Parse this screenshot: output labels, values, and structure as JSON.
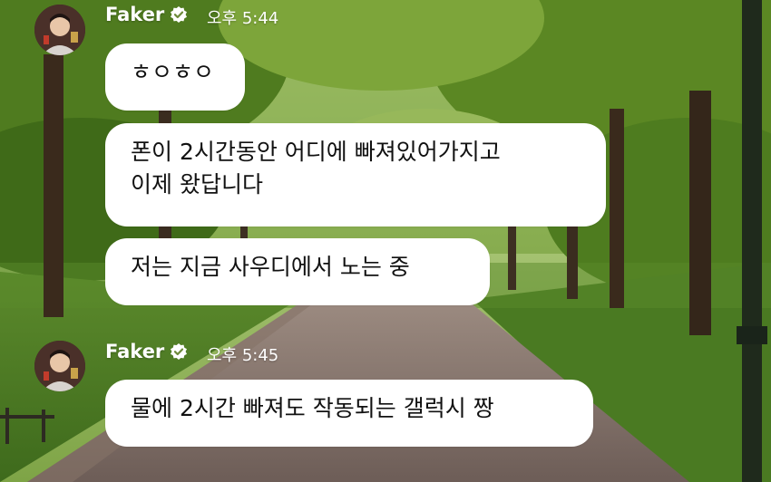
{
  "messages": [
    {
      "sender": "Faker",
      "time": "오후 5:44",
      "bubbles": [
        {
          "lines": [
            "ㅎㅇㅎㅇ"
          ]
        },
        {
          "lines": [
            "폰이 2시간동안 어디에 빠져있어가지고",
            "이제 왔답니다"
          ]
        },
        {
          "lines": [
            "저는 지금 사우디에서 노는 중"
          ]
        }
      ]
    },
    {
      "sender": "Faker",
      "time": "오후 5:45",
      "bubbles": [
        {
          "lines": [
            "물에 2시간 빠져도 작동되는 갤럭시 짱"
          ]
        }
      ]
    }
  ],
  "icons": {
    "verified": "verified-check-icon",
    "avatar": "profile-avatar"
  },
  "colors": {
    "bubble": "#ffffff",
    "text": "#111111",
    "name": "#ffffff"
  }
}
